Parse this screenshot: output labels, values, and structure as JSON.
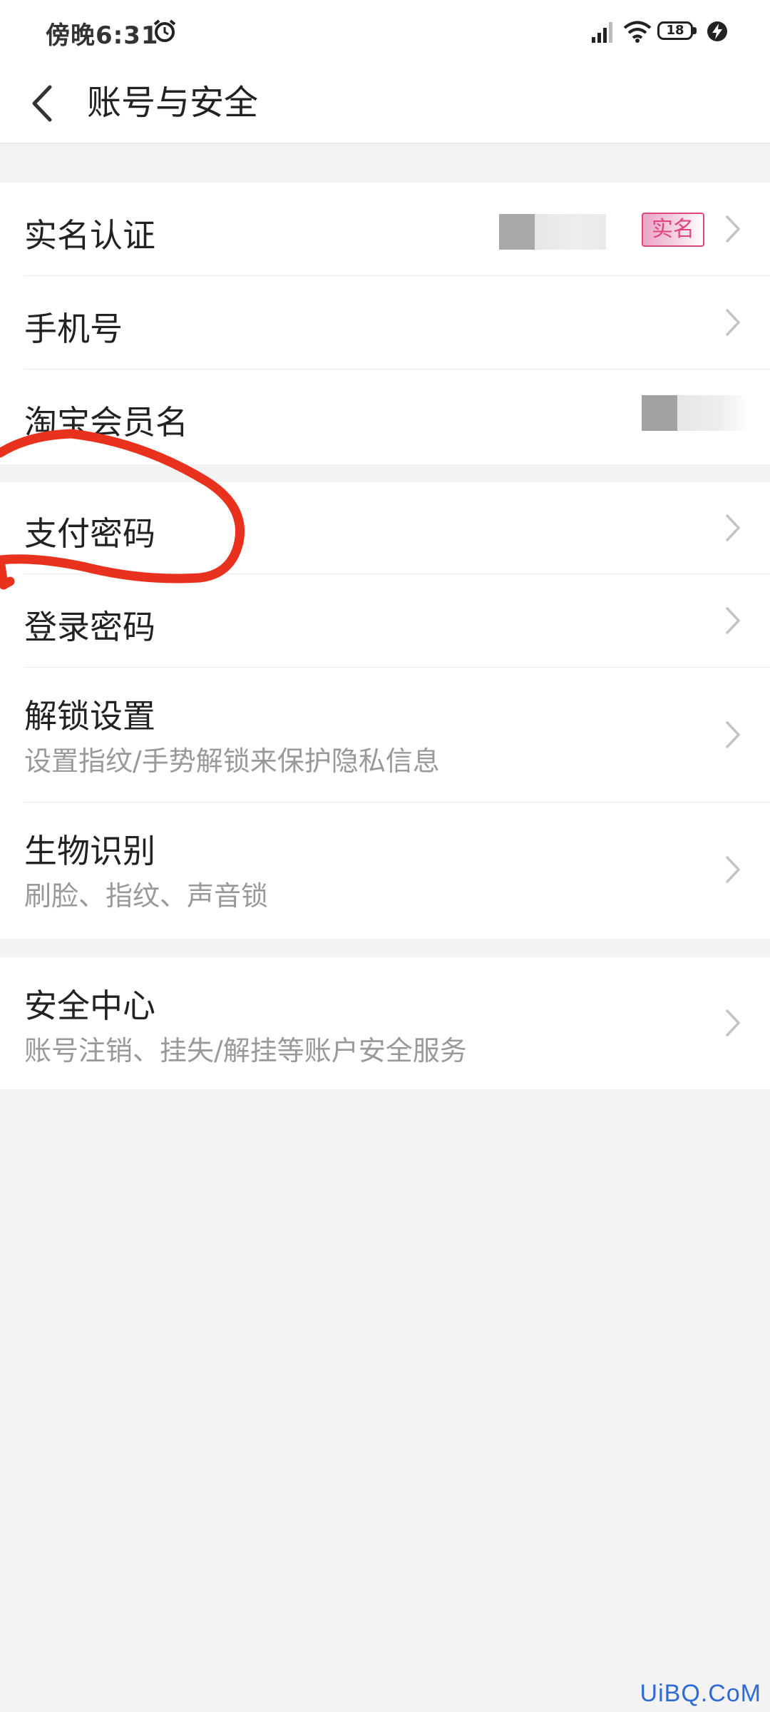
{
  "status": {
    "time": "傍晚6:31",
    "battery": "18",
    "icons": [
      "alarm-icon",
      "signal-icon",
      "wifi-icon",
      "battery-icon",
      "charging-icon"
    ]
  },
  "header": {
    "title": "账号与安全",
    "back_icon": "chevron-left-icon"
  },
  "groups": [
    {
      "items": [
        {
          "label": "实名认证",
          "tag": "实名"
        },
        {
          "label": "手机号"
        },
        {
          "label": "淘宝会员名"
        }
      ]
    },
    {
      "items": [
        {
          "label": "支付密码"
        },
        {
          "label": "登录密码"
        },
        {
          "label": "解锁设置",
          "sub": "设置指纹/手势解锁来保护隐私信息"
        },
        {
          "label": "生物识别",
          "sub": "刷脸、指纹、声音锁"
        }
      ]
    },
    {
      "items": [
        {
          "label": "安全中心",
          "sub": "账号注销、挂失/解挂等账户安全服务"
        }
      ]
    }
  ],
  "watermark": "UiBQ.CoM",
  "colors": {
    "accent_tag": "#e0457b",
    "annotation": "#e8321e"
  }
}
